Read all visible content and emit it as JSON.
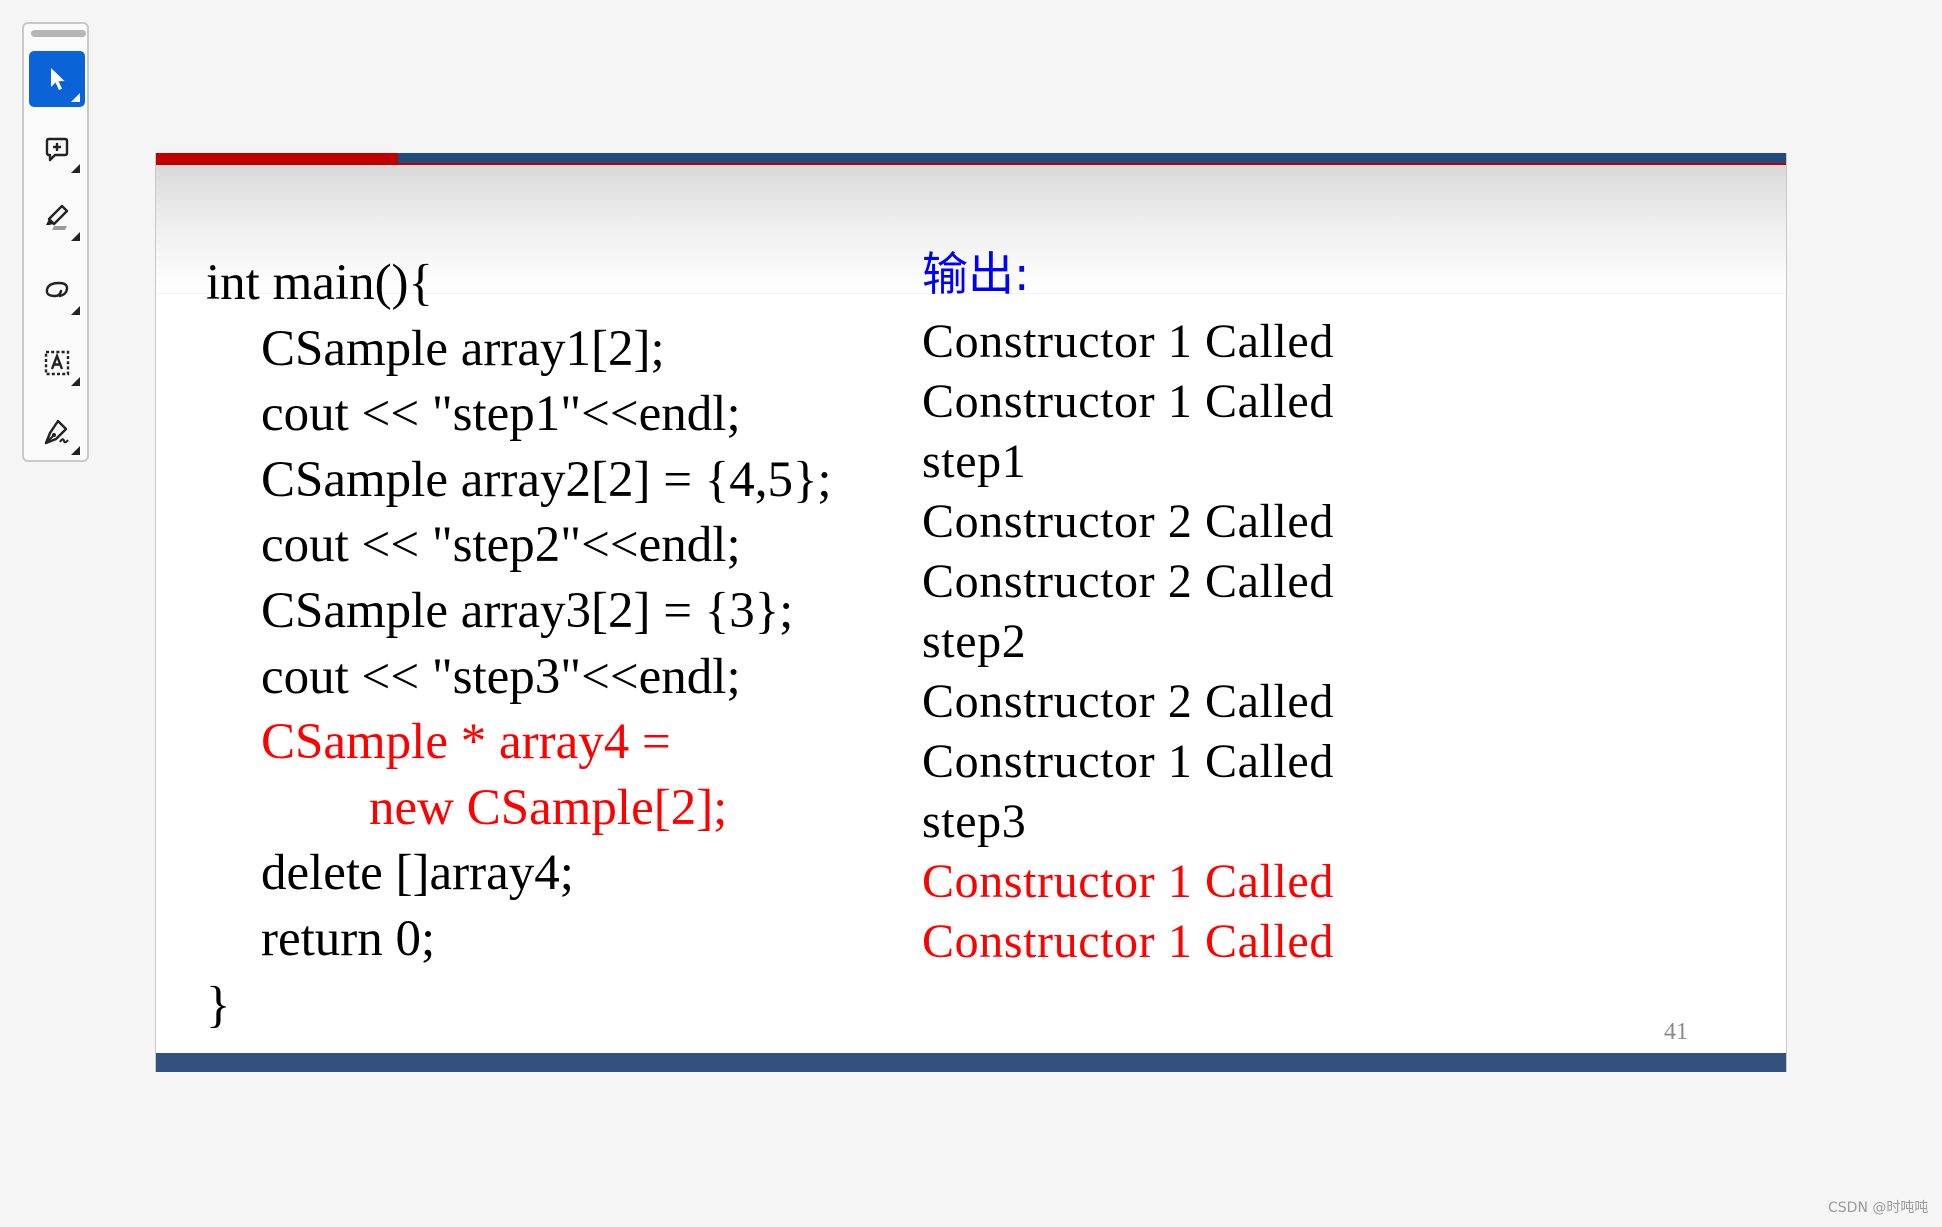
{
  "toolbar": {
    "tools": [
      {
        "name": "select",
        "icon": "cursor-arrow-icon",
        "active": true
      },
      {
        "name": "add-comment",
        "icon": "comment-plus-icon",
        "active": false
      },
      {
        "name": "highlight",
        "icon": "highlighter-icon",
        "active": false
      },
      {
        "name": "freehand",
        "icon": "lasso-icon",
        "active": false
      },
      {
        "name": "text-box",
        "icon": "text-box-icon",
        "active": false
      },
      {
        "name": "sign",
        "icon": "pen-signature-icon",
        "active": false
      }
    ],
    "accent_color": "#0b63d8"
  },
  "slide": {
    "code": {
      "lines": [
        {
          "text": "int main(){",
          "indent": 0,
          "highlight": false
        },
        {
          "text": "CSample array1[2];",
          "indent": 1,
          "highlight": false
        },
        {
          "text": "cout << \"step1\"<<endl;",
          "indent": 1,
          "highlight": false
        },
        {
          "text": "CSample array2[2] = {4,5};",
          "indent": 1,
          "highlight": false
        },
        {
          "text": "cout << \"step2\"<<endl;",
          "indent": 1,
          "highlight": false
        },
        {
          "text": "CSample array3[2] = {3};",
          "indent": 1,
          "highlight": false
        },
        {
          "text": "cout << \"step3\"<<endl;",
          "indent": 1,
          "highlight": false
        },
        {
          "text": "CSample * array4 =",
          "indent": 1,
          "highlight": true
        },
        {
          "text": "new CSample[2];",
          "indent": 2,
          "highlight": true
        },
        {
          "text": "delete []array4;",
          "indent": 1,
          "highlight": false
        },
        {
          "text": "return 0;",
          "indent": 1,
          "highlight": false
        },
        {
          "text": "}",
          "indent": 0,
          "highlight": false
        }
      ]
    },
    "output": {
      "title": "输出:",
      "title_color": "#0000ff",
      "lines": [
        {
          "text": "Constructor 1 Called",
          "highlight": false
        },
        {
          "text": "Constructor 1 Called",
          "highlight": false
        },
        {
          "text": "step1",
          "highlight": false
        },
        {
          "text": "Constructor 2 Called",
          "highlight": false
        },
        {
          "text": "Constructor 2 Called",
          "highlight": false
        },
        {
          "text": "step2",
          "highlight": false
        },
        {
          "text": "Constructor 2 Called",
          "highlight": false
        },
        {
          "text": "Constructor 1 Called",
          "highlight": false
        },
        {
          "text": "step3",
          "highlight": false
        },
        {
          "text": "Constructor 1 Called",
          "highlight": true
        },
        {
          "text": "Constructor 1 Called",
          "highlight": true
        }
      ]
    },
    "highlight_color": "#ff0000",
    "page_number": "41",
    "colors": {
      "top_bar_red": "#c00000",
      "top_bar_blue": "#1f4b7e",
      "bottom_bar": "#34507f"
    }
  },
  "watermark": "CSDN @时吨吨"
}
